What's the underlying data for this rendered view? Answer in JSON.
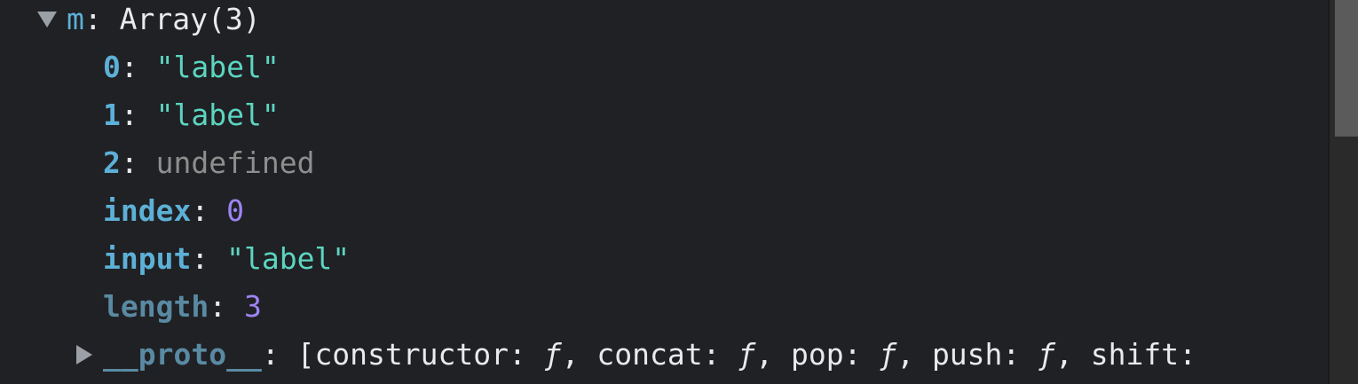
{
  "object": {
    "name": "m",
    "summary": "Array(3)",
    "entries": [
      {
        "key": "0",
        "value": "\"label\""
      },
      {
        "key": "1",
        "value": "\"label\""
      },
      {
        "key": "2",
        "value": "undefined"
      },
      {
        "key": "index",
        "value": "0"
      },
      {
        "key": "input",
        "value": "\"label\""
      },
      {
        "key": "length",
        "value": "3"
      }
    ],
    "proto": {
      "key": "__proto__",
      "open_bracket": "[",
      "items": [
        {
          "key": "constructor",
          "value": "ƒ"
        },
        {
          "key": "concat",
          "value": "ƒ"
        },
        {
          "key": "pop",
          "value": "ƒ"
        },
        {
          "key": "push",
          "value": "ƒ"
        },
        {
          "key": "shift",
          "value": ""
        }
      ]
    }
  },
  "icons": {
    "expanded": "triangle-down-icon",
    "collapsed": "triangle-right-icon"
  },
  "colors": {
    "background": "#202124",
    "key": "#5db0d7",
    "string": "#5cd5c1",
    "number": "#9d84f5",
    "undefined": "#8e8e8e"
  }
}
